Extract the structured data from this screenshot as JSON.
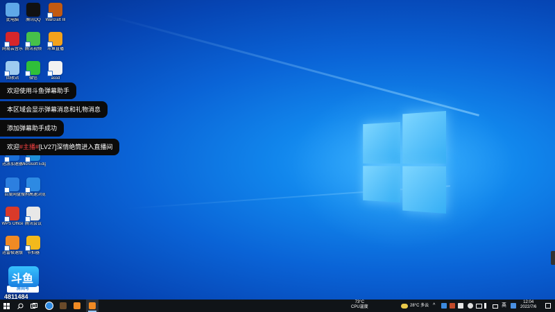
{
  "desktop": {
    "icons": [
      {
        "label": "此电脑",
        "icon": "computer-icon",
        "color": "#5fa8e8"
      },
      {
        "label": "腾讯QQ",
        "icon": "qq-penguin-icon",
        "color": "#111111"
      },
      {
        "label": "Warcraft III",
        "icon": "warcraft-icon",
        "color": "#c25a12"
      },
      {
        "label": "网易云音乐",
        "icon": "netease-music-icon",
        "color": "#d6262a"
      },
      {
        "label": "腾讯视频",
        "icon": "tencent-video-icon",
        "color": "#46c04a"
      },
      {
        "label": "斗鱼直播",
        "icon": "douyu-icon",
        "color": "#f3a21b"
      },
      {
        "label": "回收站",
        "icon": "recycle-bin-icon",
        "color": "#9ecbf0"
      },
      {
        "label": "微信",
        "icon": "wechat-icon",
        "color": "#2fbf3a"
      },
      {
        "label": "assd",
        "icon": "file-icon",
        "color": "#f2f2f2"
      },
      {
        "label": "迅游加速器",
        "icon": "accelerator-icon",
        "color": "#1b6fd6"
      },
      {
        "label": "Microsoft Edge",
        "icon": "edge-icon",
        "color": "#1f8fd8"
      },
      {
        "label": "百度网盘",
        "icon": "baidu-netdisk-icon",
        "color": "#2c7fe0"
      },
      {
        "label": "搜狗高速浏览器",
        "icon": "sogou-browser-icon",
        "color": "#2d8ae3"
      },
      {
        "label": "WPS Office",
        "icon": "wps-icon",
        "color": "#d93a2a"
      },
      {
        "label": "腾讯会议",
        "icon": "tencent-meeting-icon",
        "color": "#e8e8e8"
      },
      {
        "label": "迅雷极速版",
        "icon": "thunder-icon",
        "color": "#f08a24"
      },
      {
        "label": "节拍器",
        "icon": "owl-icon",
        "color": "#f3b91c"
      }
    ]
  },
  "toasts": [
    {
      "text": "欢迎使用斗鱼弹幕助手"
    },
    {
      "text": "本区域会显示弹幕消息和礼物消息"
    },
    {
      "text": "添加弹幕助手成功"
    },
    {
      "prefix": "欢迎",
      "highlight": "#主播#",
      "rest": "[LV27]深情绝筒进入直播间"
    }
  ],
  "badge": {
    "logo_text": "斗鱼",
    "tag": "房间号",
    "number": "4811484"
  },
  "taskbar": {
    "weather_temp": "73°C",
    "weather_label": "CPU温度",
    "tray_weather": "28°C 多云",
    "time": "12:04",
    "date": "2022/7/6"
  },
  "colors": {
    "taskbar": "#101418",
    "toast_bg": "#0b0b0b",
    "highlight": "#ff4444"
  }
}
